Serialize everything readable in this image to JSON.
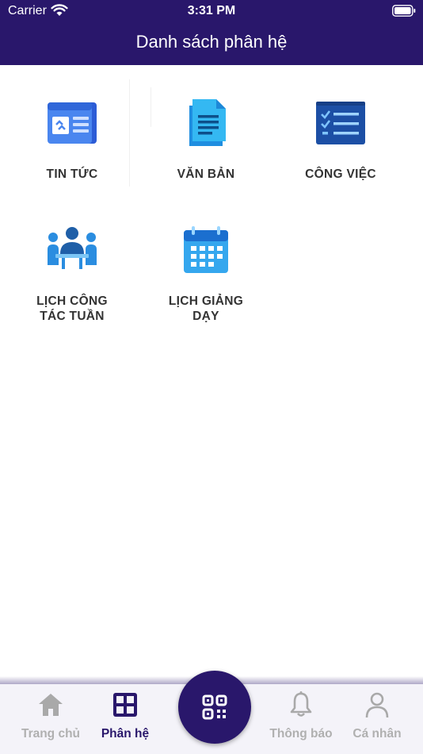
{
  "status_bar": {
    "carrier": "Carrier",
    "time": "3:31 PM"
  },
  "header": {
    "title": "Danh sách phân hệ"
  },
  "modules": [
    {
      "label": "TIN TỨC",
      "icon": "newspaper-icon"
    },
    {
      "label": "VĂN BẢN",
      "icon": "document-icon"
    },
    {
      "label": "CÔNG VIỆC",
      "icon": "task-list-icon"
    },
    {
      "label": "LỊCH CÔNG TÁC TUẦN",
      "icon": "meeting-icon"
    },
    {
      "label": "LỊCH GIẢNG DẠY",
      "icon": "calendar-icon"
    }
  ],
  "tabbar": {
    "items": [
      {
        "label": "Trang chủ",
        "icon": "home-icon",
        "active": false
      },
      {
        "label": "Phân hệ",
        "icon": "grid-icon",
        "active": true
      },
      {
        "label": "Thông báo",
        "icon": "bell-icon",
        "active": false
      },
      {
        "label": "Cá nhân",
        "icon": "user-icon",
        "active": false
      }
    ],
    "center_icon": "qr-scan-icon"
  },
  "colors": {
    "primary": "#29176b",
    "inactive": "#b0b0b0",
    "label": "#333333"
  }
}
